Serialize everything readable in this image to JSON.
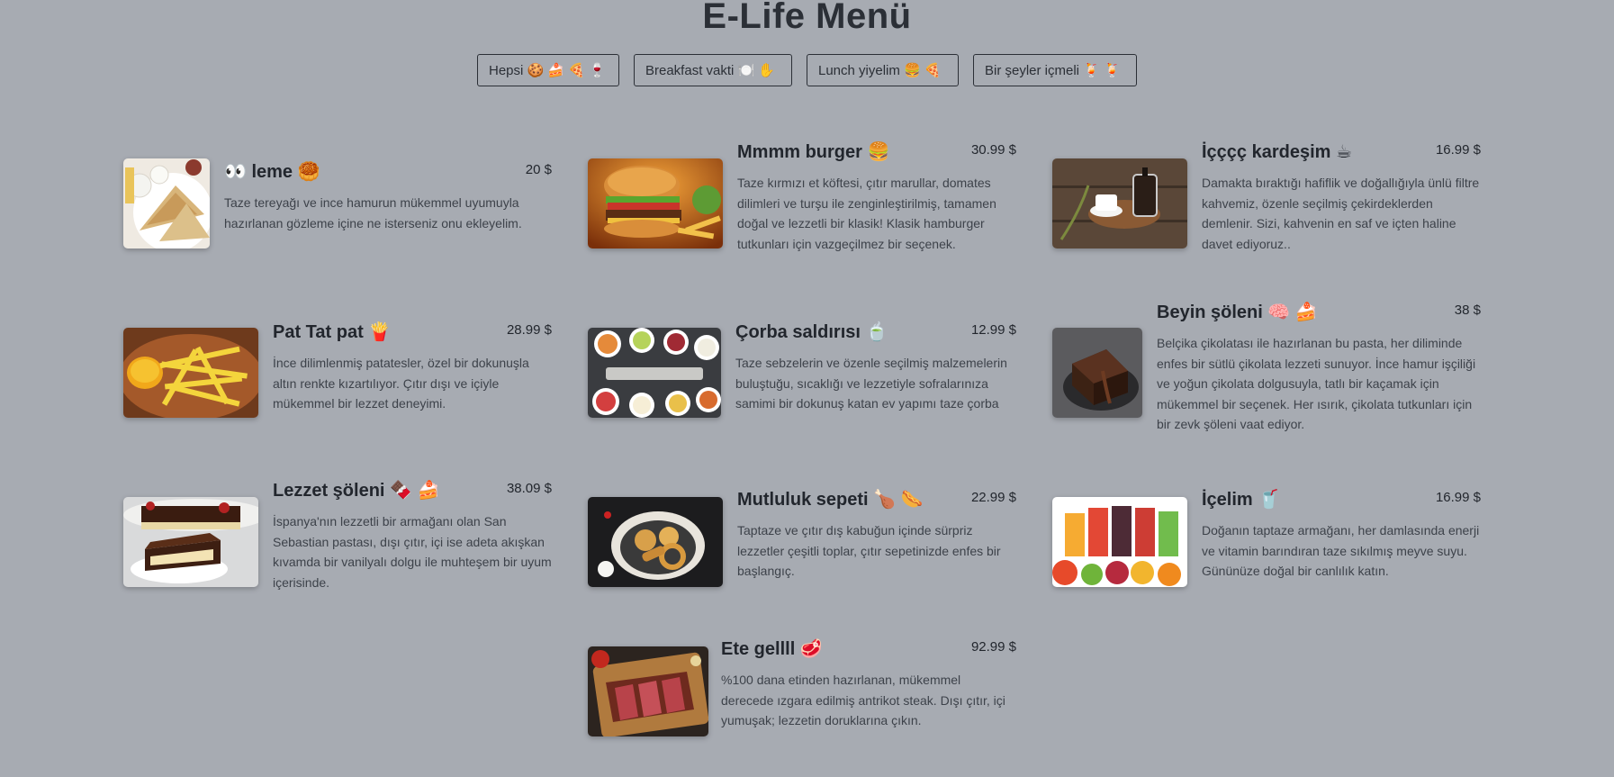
{
  "title": "E-Life Menü",
  "filters": [
    "Hepsi 🍪 🍰 🍕 🍷",
    "Breakfast vakti 🍽️ ✋",
    "Lunch yiyelim 🍔 🍕",
    "Bir şeyler içmeli 🍹 🍹"
  ],
  "items": [
    {
      "name": "👀 leme 🥮",
      "price": "20 $",
      "desc": "Taze tereyağı ve ince hamurun mükemmel uyumuyla hazırlanan gözleme içine ne isterseniz onu ekleyelim.",
      "image": "quesadilla"
    },
    {
      "name": "Mmmm burger 🍔",
      "price": "30.99 $",
      "desc": "Taze kırmızı et köftesi, çıtır marullar, domates dilimleri ve turşu ile zenginleştirilmiş, tamamen doğal ve lezzetli bir klasik! Klasik hamburger tutkunları için vazgeçilmez bir seçenek.",
      "image": "burger"
    },
    {
      "name": "İçççç kardeşim ☕",
      "price": "16.99 $",
      "desc": "Damakta bıraktığı hafiflik ve doğallığıyla ünlü filtre kahvemiz, özenle seçilmiş çekirdeklerden demlenir. Sizi, kahvenin en saf ve içten haline davet ediyoruz..",
      "image": "coffee"
    },
    {
      "name": "Pat Tat pat 🍟",
      "price": "28.99 $",
      "desc": "İnce dilimlenmiş patatesler, özel bir dokunuşla altın renkte kızartılıyor. Çıtır dışı ve içiyle mükemmel bir lezzet deneyimi.",
      "image": "fries"
    },
    {
      "name": "Çorba saldırısı 🍵",
      "price": "12.99 $",
      "desc": "Taze sebzelerin ve özenle seçilmiş malzemelerin buluştuğu, sıcaklığı ve lezzetiyle sofralarınıza samimi bir dokunuş katan ev yapımı taze çorba",
      "image": "soup"
    },
    {
      "name": "Beyin şöleni 🧠 🍰",
      "price": "38 $",
      "desc": "Belçika çikolatası ile hazırlanan bu pasta, her diliminde enfes bir sütlü çikolata lezzeti sunuyor. İnce hamur işçiliği ve yoğun çikolata dolgusuyla, tatlı bir kaçamak için mükemmel bir seçenek. Her ısırık, çikolata tutkunları için bir zevk şöleni vaat ediyor.",
      "image": "chocolate-cake"
    },
    {
      "name": "Lezzet şöleni 🍫 🍰",
      "price": "38.09 $",
      "desc": "İspanya'nın lezzetli bir armağanı olan San Sebastian pastası, dışı çıtır, içi ise adeta akışkan kıvamda bir vanilyalı dolgu ile muhteşem bir uyum içerisinde.",
      "image": "cheesecake"
    },
    {
      "name": "Mutluluk sepeti 🍗 🌭",
      "price": "22.99 $",
      "desc": "Taptaze ve çıtır dış kabuğun içinde sürpriz lezzetler çeşitli toplar, çıtır sepetinizde enfes bir başlangıç.",
      "image": "fried-basket"
    },
    {
      "name": "İçelim 🥤",
      "price": "16.99 $",
      "desc": "Doğanın taptaze armağanı, her damlasında enerji ve vitamin barındıran taze sıkılmış meyve suyu. Gününüze doğal bir canlılık katın.",
      "image": "juice"
    },
    {
      "name": "Ete gellll 🥩",
      "price": "92.99 $",
      "desc": "%100 dana etinden hazırlanan, mükemmel derecede ızgara edilmiş antrikot steak. Dışı çıtır, içi yumuşak; lezzetin doruklarına çıkın.",
      "image": "steak"
    }
  ]
}
